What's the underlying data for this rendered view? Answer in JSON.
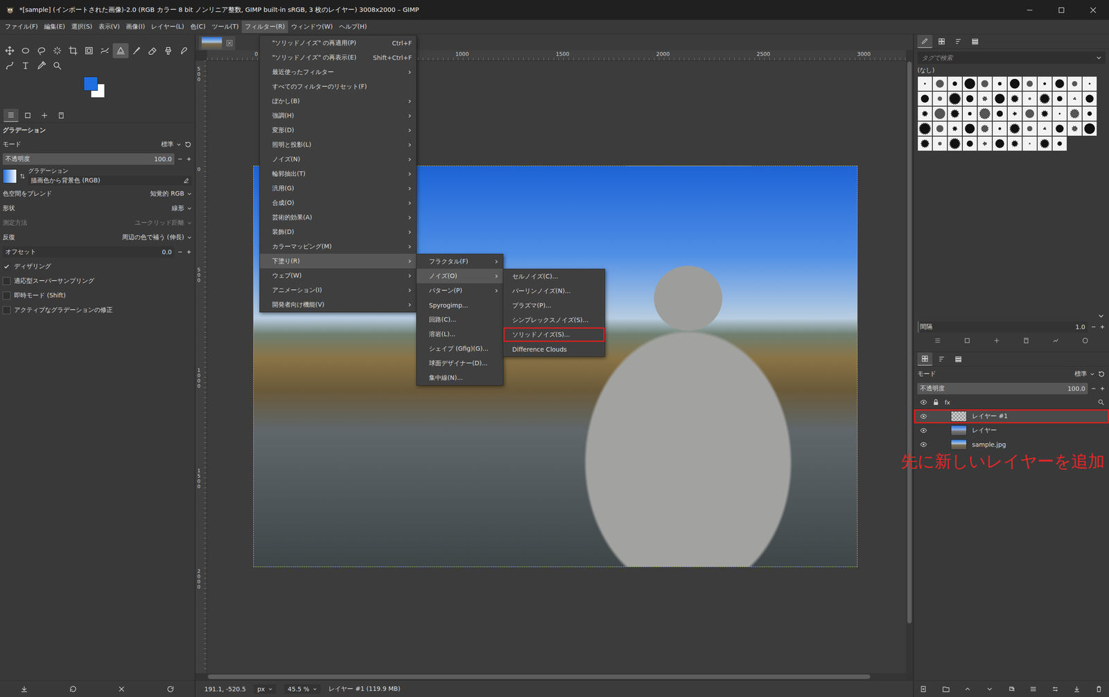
{
  "window": {
    "title": "*[sample] (インポートされた画像)-2.0 (RGB カラー 8 bit ノンリニア整数, GIMP built-in sRGB, 3 枚のレイヤー) 3008x2000 – GIMP"
  },
  "menubar": [
    {
      "label": "ファイル(F)",
      "selected": false
    },
    {
      "label": "編集(E)",
      "selected": false
    },
    {
      "label": "選択(S)",
      "selected": false
    },
    {
      "label": "表示(V)",
      "selected": false
    },
    {
      "label": "画像(I)",
      "selected": false
    },
    {
      "label": "レイヤー(L)",
      "selected": false
    },
    {
      "label": "色(C)",
      "selected": false
    },
    {
      "label": "ツール(T)",
      "selected": false
    },
    {
      "label": "フィルター(R)",
      "selected": true
    },
    {
      "label": "ウィンドウ(W)",
      "selected": false
    },
    {
      "label": "ヘルプ(H)",
      "selected": false
    }
  ],
  "filter_menu": [
    {
      "label": "\"ソリッドノイズ\" の再適用(P)",
      "shortcut": "Ctrl+F",
      "submenu": false,
      "selected": false
    },
    {
      "label": "\"ソリッドノイズ\" の再表示(E)",
      "shortcut": "Shift+Ctrl+F",
      "submenu": false,
      "selected": false
    },
    {
      "label": "最近使ったフィルター",
      "shortcut": "",
      "submenu": true,
      "selected": false
    },
    {
      "label": "すべてのフィルターのリセット(F)",
      "shortcut": "",
      "submenu": false,
      "selected": false
    },
    {
      "label": "ぼかし(B)",
      "shortcut": "",
      "submenu": true,
      "selected": false
    },
    {
      "label": "強調(H)",
      "shortcut": "",
      "submenu": true,
      "selected": false
    },
    {
      "label": "変形(D)",
      "shortcut": "",
      "submenu": true,
      "selected": false
    },
    {
      "label": "照明と投影(L)",
      "shortcut": "",
      "submenu": true,
      "selected": false
    },
    {
      "label": "ノイズ(N)",
      "shortcut": "",
      "submenu": true,
      "selected": false
    },
    {
      "label": "輪郭抽出(T)",
      "shortcut": "",
      "submenu": true,
      "selected": false
    },
    {
      "label": "汎用(G)",
      "shortcut": "",
      "submenu": true,
      "selected": false
    },
    {
      "label": "合成(O)",
      "shortcut": "",
      "submenu": true,
      "selected": false
    },
    {
      "label": "芸術的効果(A)",
      "shortcut": "",
      "submenu": true,
      "selected": false
    },
    {
      "label": "装飾(D)",
      "shortcut": "",
      "submenu": true,
      "selected": false
    },
    {
      "label": "カラーマッピング(M)",
      "shortcut": "",
      "submenu": true,
      "selected": false
    },
    {
      "label": "下塗り(R)",
      "shortcut": "",
      "submenu": true,
      "selected": true
    },
    {
      "label": "ウェブ(W)",
      "shortcut": "",
      "submenu": true,
      "selected": false
    },
    {
      "label": "アニメーション(I)",
      "shortcut": "",
      "submenu": true,
      "selected": false
    },
    {
      "label": "開発者向け機能(V)",
      "shortcut": "",
      "submenu": true,
      "selected": false
    }
  ],
  "render_menu": [
    {
      "label": "フラクタル(F)",
      "submenu": true,
      "selected": false
    },
    {
      "label": "ノイズ(O)",
      "submenu": true,
      "selected": true
    },
    {
      "label": "パターン(P)",
      "submenu": true,
      "selected": false
    },
    {
      "label": "Spyrogimp...",
      "submenu": false,
      "selected": false
    },
    {
      "label": "回路(C)...",
      "submenu": false,
      "selected": false
    },
    {
      "label": "溶岩(L)...",
      "submenu": false,
      "selected": false
    },
    {
      "label": "シェイプ (Gfig)(G)...",
      "submenu": false,
      "selected": false
    },
    {
      "label": "球面デザイナー(D)...",
      "submenu": false,
      "selected": false
    },
    {
      "label": "集中線(N)...",
      "submenu": false,
      "selected": false
    }
  ],
  "noise_menu": [
    {
      "label": "セルノイズ(C)...",
      "selected": false,
      "marked": false
    },
    {
      "label": "パーリンノイズ(N)...",
      "selected": false,
      "marked": false
    },
    {
      "label": "プラズマ(P)...",
      "selected": false,
      "marked": false
    },
    {
      "label": "シンプレックスノイズ(S)...",
      "selected": false,
      "marked": false
    },
    {
      "label": "ソリッドノイズ(S)...",
      "selected": false,
      "marked": true
    },
    {
      "label": "Difference Clouds",
      "selected": false,
      "marked": false
    }
  ],
  "toolbox": [
    {
      "selected": false
    },
    {
      "selected": false
    },
    {
      "selected": false
    },
    {
      "selected": false
    },
    {
      "selected": false
    },
    {
      "selected": false
    },
    {
      "selected": false
    },
    {
      "selected": true
    },
    {
      "selected": false
    },
    {
      "selected": false
    },
    {
      "selected": false
    },
    {
      "selected": false
    },
    {
      "selected": false
    },
    {
      "selected": false
    },
    {
      "selected": false
    },
    {
      "selected": false
    }
  ],
  "colors": {
    "foreground": "#1f6fe0",
    "background": "#ffffff"
  },
  "tool_tabs": [
    {
      "selected": true
    },
    {
      "selected": false
    },
    {
      "selected": false
    },
    {
      "selected": false
    }
  ],
  "tool_options": {
    "title": "グラデーション",
    "rows": [
      {
        "kind": "select",
        "label": "モード",
        "value": "標準",
        "reset": true,
        "disabled": false
      },
      {
        "kind": "slider",
        "label": "不透明度",
        "value": "100.0",
        "level": 1
      },
      {
        "kind": "gradient",
        "label": "グラデーション",
        "value": "描画色から背景色 (RGB)"
      },
      {
        "kind": "select",
        "label": "色空間をブレンド",
        "value": "知覚的 RGB",
        "reset": false,
        "disabled": false
      },
      {
        "kind": "select",
        "label": "形状",
        "value": "線形",
        "reset": false,
        "disabled": false
      },
      {
        "kind": "select",
        "label": "測定方法",
        "value": "ユークリッド距離",
        "reset": false,
        "disabled": true
      },
      {
        "kind": "select",
        "label": "反復",
        "value": "周辺の色で補う (伸長)",
        "reset": false,
        "disabled": false
      },
      {
        "kind": "slider",
        "label": "オフセット",
        "value": "0.0",
        "level": 0
      },
      {
        "kind": "check",
        "label": "ディザリング",
        "checked": true
      },
      {
        "kind": "check",
        "label": "適応型スーパーサンプリング",
        "checked": false
      },
      {
        "kind": "check",
        "label": "即時モード (Shift)",
        "checked": false
      },
      {
        "kind": "check",
        "label": "アクティブなグラデーションの修正",
        "checked": false
      }
    ]
  },
  "canvas": {
    "ruler_h": [
      "0",
      "1000",
      "1500",
      "2000",
      "2500",
      "3000"
    ],
    "ruler_v": [
      "500",
      "0",
      "500",
      "1000",
      "1500",
      "2000"
    ]
  },
  "brush_tabs": [
    {
      "selected": true
    },
    {
      "selected": false
    },
    {
      "selected": false
    },
    {
      "selected": false
    }
  ],
  "brushes": {
    "search_placeholder": "タグで検索",
    "tag": "(なし)",
    "spacing_label": "間隔",
    "spacing_value": "1.0",
    "spacing_level": 0.01
  },
  "layer_tabs": [
    {
      "selected": true
    },
    {
      "selected": false
    },
    {
      "selected": false
    }
  ],
  "layers": {
    "mode_label": "モード",
    "mode": "標準",
    "opacity_label": "不透明度",
    "opacity": "100.0",
    "opacity_level": 1,
    "header_fx": "fx",
    "items": [
      {
        "name": "レイヤー #1",
        "selected": true,
        "marked": true,
        "visible": true,
        "kind": "transparent"
      },
      {
        "name": "レイヤー",
        "selected": false,
        "marked": false,
        "visible": true,
        "kind": "sky"
      },
      {
        "name": "sample.jpg",
        "selected": false,
        "marked": false,
        "visible": true,
        "kind": "photo"
      }
    ]
  },
  "annotation": "先に新しいレイヤーを追加",
  "status_bar": {
    "coords": "191.1, -520.5",
    "unit": "px",
    "zoom": "45.5 %",
    "info": "レイヤー #1 (119.9 MB)"
  }
}
